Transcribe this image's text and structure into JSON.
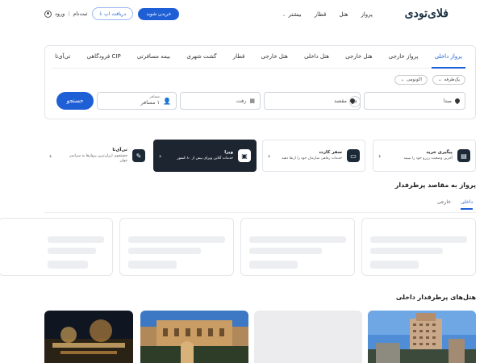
{
  "header": {
    "logo": "فلای‌تودی",
    "nav": [
      "پرواز",
      "هتل",
      "قطار",
      "بیشتر"
    ],
    "btn_app": "دریافت اپ",
    "btn_buy": "خریدن شوید",
    "login_label": "ورود",
    "signup_label": "ثبت‌نام"
  },
  "search": {
    "tabs": [
      "پرواز داخلی",
      "پرواز خارجی",
      "هتل خارجی",
      "هتل داخلی",
      "هتل خارجی",
      "قطار",
      "گشت شهری",
      "بیمه مسافرتی",
      "CIP فرودگاهی",
      "تی‌آی‌تا"
    ],
    "active_tab": 0,
    "trip_type": "یک‌طرفه",
    "class_select": "اکونومی",
    "origin_placeholder": "مبدا",
    "dest_placeholder": "مقصد",
    "date_placeholder": "رفت",
    "passenger_label": "مسافر",
    "passenger_value": "۱ مسافر",
    "search_button": "جستجو"
  },
  "services": [
    {
      "title": "پیگیری خرید",
      "desc": "آخرین وضعیت رزرو خود را ببینید",
      "icon": "ticket-icon",
      "dark": false
    },
    {
      "title": "سفر کارت",
      "desc": "خدمات رفاهی سازمان خود را ارتقا دهید",
      "icon": "card-icon",
      "dark": false
    },
    {
      "title": "ویزا",
      "desc": "خدمات آنلاین ویزای بیش از ۸۰ کشور",
      "icon": "passport-icon",
      "dark": true
    },
    {
      "title": "تی‌آی‌تا",
      "desc": "جستجوی ارزان‌ترین پروازها به سراسر جهان",
      "icon": "plane-ticket-icon",
      "dark": false
    }
  ],
  "popular_flights": {
    "title": "پرواز به مقاصد پرطرفدار",
    "tabs": [
      "داخلی",
      "خارجی"
    ],
    "active_tab": 0
  },
  "popular_hotels": {
    "title": "هتل‌های پرطرفدار داخلی"
  },
  "colors": {
    "accent": "#1f5fd6",
    "dark": "#1c2530"
  }
}
